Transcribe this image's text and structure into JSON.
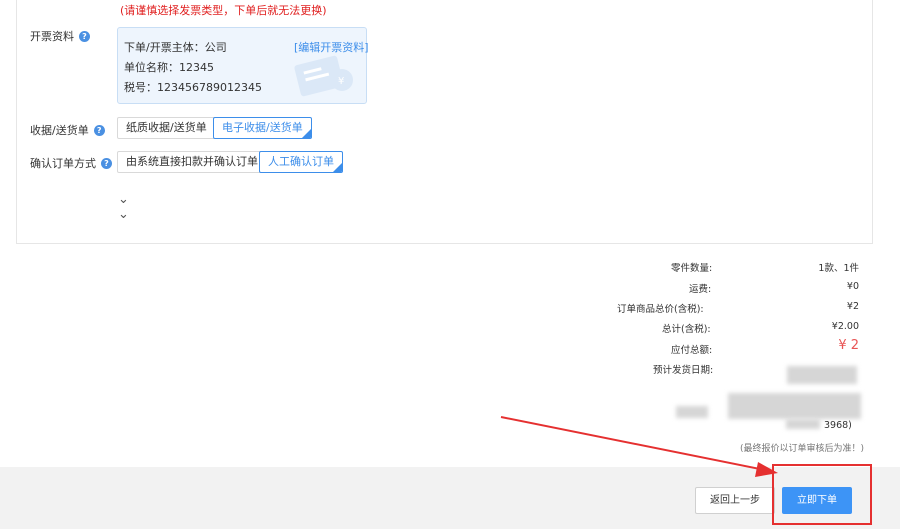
{
  "warning": "(请谨慎选择发票类型，下单后就无法更换)",
  "invoice": {
    "label": "开票资料",
    "subject": "下单/开票主体：公司",
    "edit_link": "[编辑开票资料]",
    "company_name": "单位名称：12345",
    "tax_id": "税号：123456789012345"
  },
  "receipt": {
    "label": "收据/送货单",
    "options": [
      "纸质收据/送货单",
      "电子收据/送货单"
    ],
    "selected": "电子收据/送货单"
  },
  "confirm_method": {
    "label": "确认订单方式",
    "options": [
      "由系统直接扣款并确认订单",
      "人工确认订单"
    ],
    "selected": "人工确认订单"
  },
  "summary": {
    "parts_qty_label": "零件数量:",
    "parts_qty_value": "1款、1件",
    "shipping_label": "运费:",
    "shipping_value": "¥0",
    "goods_total_label": "订单商品总价(含税):",
    "goods_total_value": "¥2",
    "total_label": "总计(含税):",
    "total_value": "¥2.00",
    "payable_label": "应付总额:",
    "payable_value": "¥ 2",
    "ship_date_label": "预计发货日期:",
    "partial_phone": "3968)",
    "note": "(最终报价以订单审核后为准！)"
  },
  "footer": {
    "back_label": "返回上一步",
    "order_label": "立即下单"
  },
  "colors": {
    "accent": "#3d94f6",
    "warning": "#e02020",
    "price": "#e85454",
    "annotation": "#e53030"
  }
}
